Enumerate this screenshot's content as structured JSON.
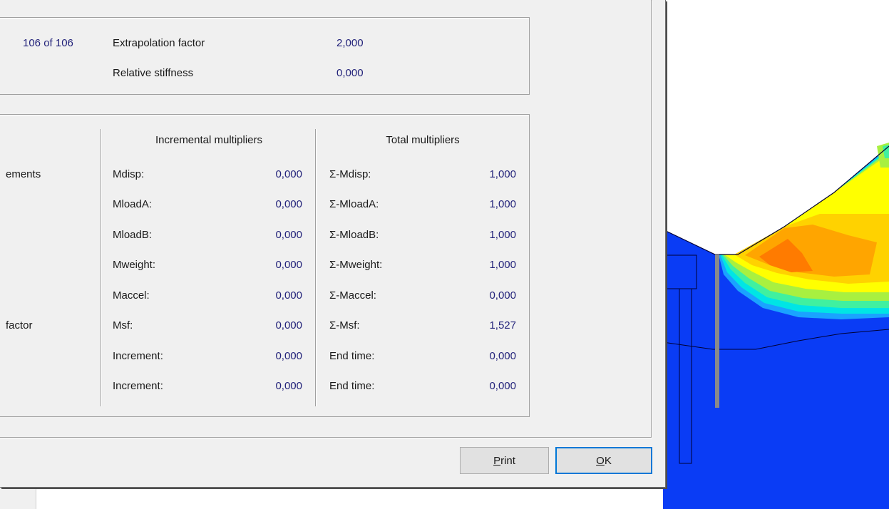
{
  "iteration": {
    "step": "106 of 106"
  },
  "top_info": {
    "extrapolation_label": "Extrapolation factor",
    "extrapolation_value": "2,000",
    "stiffness_label": "Relative stiffness",
    "stiffness_value": "0,000"
  },
  "left_cut_labels": {
    "row1": "ements",
    "row2": "factor"
  },
  "multipliers": {
    "incremental_header": "Incremental multipliers",
    "total_header": "Total multipliers",
    "rows": [
      {
        "inc_label": "Mdisp:",
        "inc_value": "0,000",
        "tot_label": "Σ-Mdisp:",
        "tot_value": "1,000"
      },
      {
        "inc_label": "MloadA:",
        "inc_value": "0,000",
        "tot_label": "Σ-MloadA:",
        "tot_value": "1,000"
      },
      {
        "inc_label": "MloadB:",
        "inc_value": "0,000",
        "tot_label": "Σ-MloadB:",
        "tot_value": "1,000"
      },
      {
        "inc_label": "Mweight:",
        "inc_value": "0,000",
        "tot_label": "Σ-Mweight:",
        "tot_value": "1,000"
      },
      {
        "inc_label": "Maccel:",
        "inc_value": "0,000",
        "tot_label": "Σ-Maccel:",
        "tot_value": "0,000"
      },
      {
        "inc_label": "Msf:",
        "inc_value": "0,000",
        "tot_label": "Σ-Msf:",
        "tot_value": "1,527"
      },
      {
        "inc_label": "Increment:",
        "inc_value": "0,000",
        "tot_label": "End time:",
        "tot_value": "0,000"
      },
      {
        "inc_label": "Increment:",
        "inc_value": "0,000",
        "tot_label": "End time:",
        "tot_value": "0,000"
      }
    ]
  },
  "buttons": {
    "print_mnemonic": "P",
    "print_rest": "rint",
    "ok_mnemonic": "O",
    "ok_rest": "K"
  },
  "colors": {
    "dialog_bg": "#f0f0f0",
    "soil_blue": "#0a3cf5",
    "value_text": "#22227a",
    "contour_orange": "#ff8c00",
    "contour_yellow": "#ffff00"
  }
}
